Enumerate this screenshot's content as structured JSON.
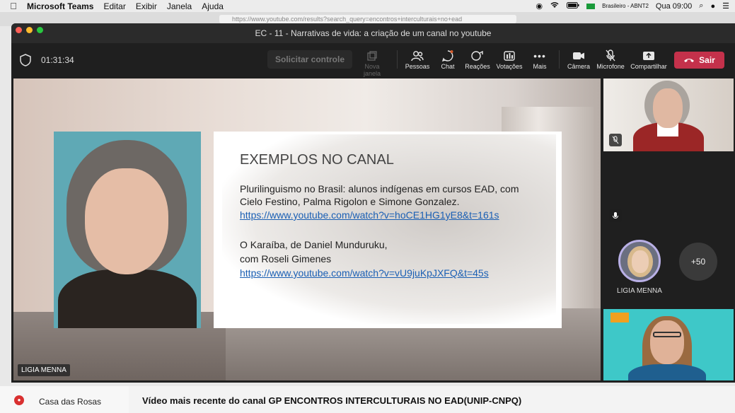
{
  "menubar": {
    "app": "Microsoft Teams",
    "items": [
      "Editar",
      "Exibir",
      "Janela",
      "Ajuda"
    ],
    "keyboard": "Brasileiro - ABNT2",
    "clock": "Qua 09:00"
  },
  "browser": {
    "url": "https://www.youtube.com/results?search_query=encontros+interculturais+no+ead"
  },
  "window": {
    "title": "EC - 11 - Narrativas de vida: a criação de um canal no youtube"
  },
  "toolbar": {
    "timer": "01:31:34",
    "request_control": "Solicitar controle",
    "new_window": "Nova janela",
    "people": "Pessoas",
    "chat": "Chat",
    "reactions": "Reações",
    "polls": "Votações",
    "more": "Mais",
    "camera": "Câmera",
    "microphone": "Microfone",
    "share": "Compartilhar",
    "leave": "Sair"
  },
  "slide": {
    "title": "EXEMPLOS NO CANAL",
    "item1_line1": "Plurilinguismo no Brasil: alunos indígenas em cursos EAD, com",
    "item1_line2": "Cielo Festino, Palma Rigolon e Simone Gonzalez.",
    "item1_link": "https://www.youtube.com/watch?v=hoCE1HG1yE8&t=161s",
    "item2_line1": "O Karaíba, de Daniel Munduruku,",
    "item2_line2": "com Roseli Gimenes",
    "item2_link": "https://www.youtube.com/watch?v=vU9juKpJXFQ&t=45s"
  },
  "stage": {
    "speaker_name": "LIGIA MENNA"
  },
  "participants": {
    "avatar_name": "LIGIA MENNA",
    "more_count": "+50"
  },
  "behind": {
    "sidebar_item": "Casa das Rosas",
    "video_title": "Vídeo mais recente do canal GP ENCONTROS INTERCULTURAIS NO EAD(UNIP-CNPQ)"
  }
}
